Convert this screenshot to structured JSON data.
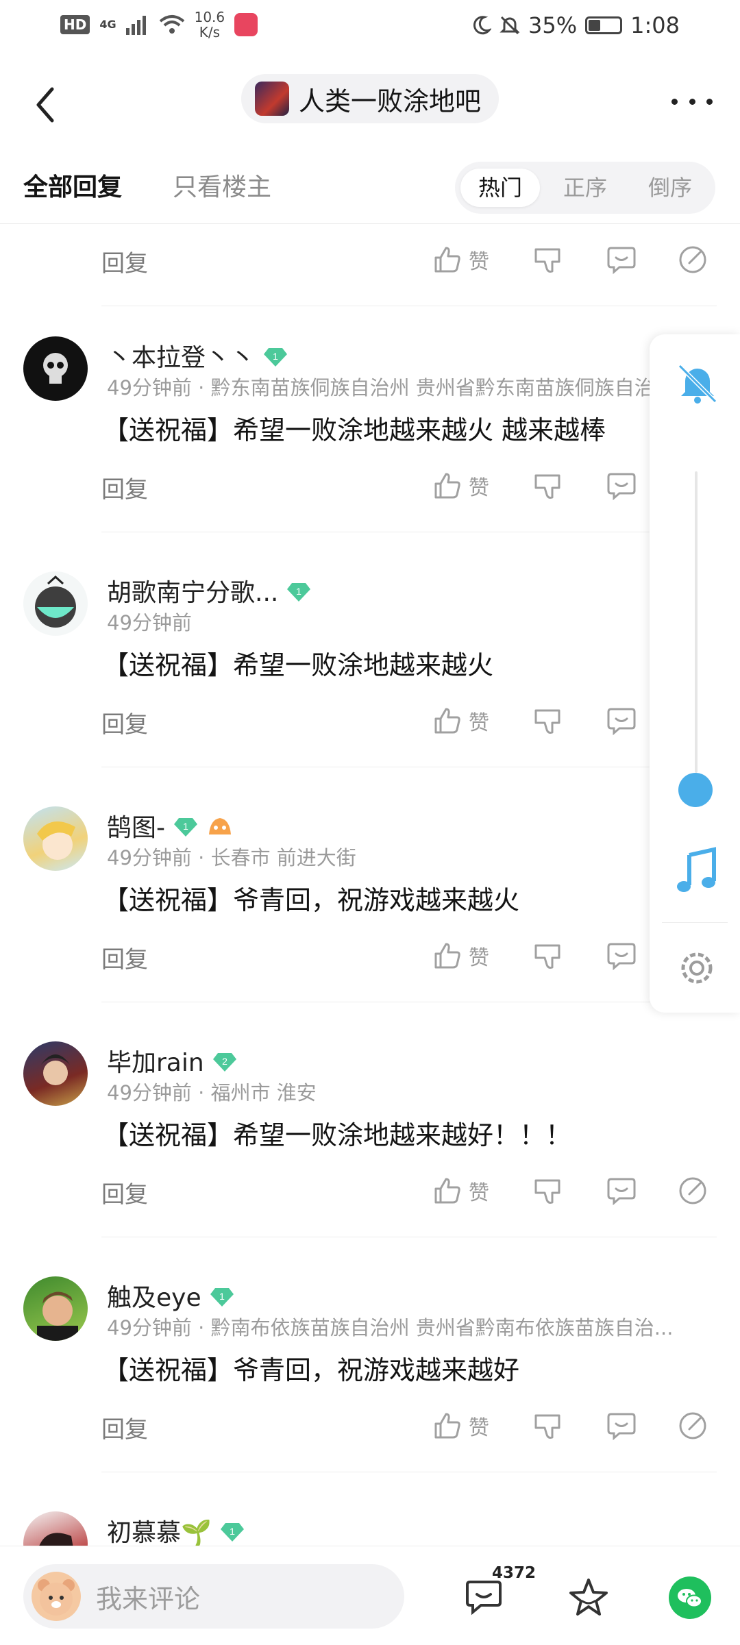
{
  "status_bar": {
    "hd": "HD",
    "network": "4G",
    "speed_value": "10.6",
    "speed_unit": "K/s",
    "battery": "35%",
    "battery_level": 0.35,
    "time": "1:08",
    "icons": [
      "moon-icon",
      "mute-bell-icon",
      "wifi-icon",
      "signal-icon"
    ]
  },
  "nav": {
    "forum_name": "人类一败涂地吧"
  },
  "tabs": {
    "all": "全部回复",
    "owner_only": "只看楼主",
    "sort_hot": "热门",
    "sort_asc": "正序",
    "sort_desc": "倒序",
    "active_sort": "热门"
  },
  "actions": {
    "reply": "回复",
    "like": "赞"
  },
  "comments": [
    {
      "user": "丶本拉登丶丶",
      "level": "1",
      "time": "49分钟前",
      "location": "黔东南苗族侗族自治州 贵州省黔东南苗族侗族自治...",
      "text": "【送祝福】希望一败涂地越来越火 越来越棒"
    },
    {
      "user": "胡歌南宁分歌...",
      "level": "1",
      "time": "49分钟前",
      "location": "",
      "text": "【送祝福】希望一败涂地越来越火"
    },
    {
      "user": "鹄图-",
      "level": "1",
      "time": "49分钟前",
      "location": "长春市 前进大街",
      "text": "【送祝福】爷青回，祝游戏越来越火"
    },
    {
      "user": "毕加rain",
      "level": "2",
      "time": "49分钟前",
      "location": "福州市 淮安",
      "text": "【送祝福】希望一败涂地越来越好！！！"
    },
    {
      "user": "触及eye",
      "level": "1",
      "time": "49分钟前",
      "location": "黔南布依族苗族自治州 贵州省黔南布依族苗族自治...",
      "text": "【送祝福】爷青回，祝游戏越来越好"
    },
    {
      "user": "初慕慕🌱",
      "level": "1",
      "time": "",
      "location": "",
      "text": ""
    }
  ],
  "bottom_bar": {
    "placeholder": "我来评论",
    "comment_count": "4372"
  },
  "colors": {
    "level_badge": "#4cc99a",
    "accent_blue": "#4aaee9",
    "wechat_green": "#1fbf5d"
  }
}
